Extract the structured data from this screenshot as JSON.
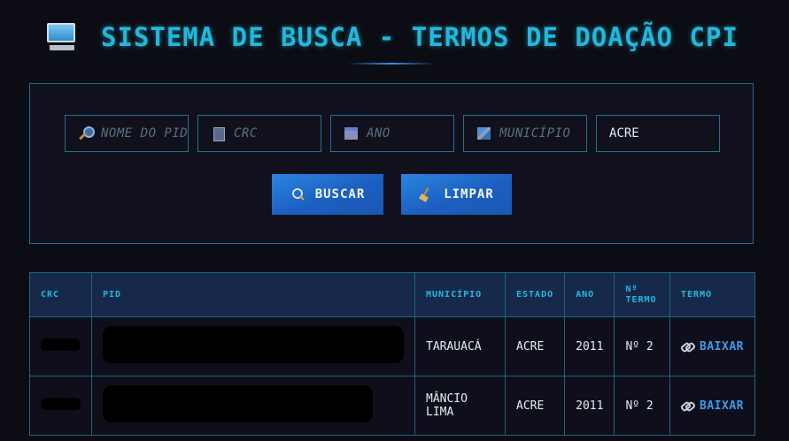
{
  "header": {
    "title": "SISTEMA DE BUSCA - TERMOS DE DOAÇÃO CPI",
    "icon": "computer-icon"
  },
  "search": {
    "fields": [
      {
        "name": "pid",
        "placeholder": "NOME DO PID",
        "value": "",
        "icon": "magnifier-icon"
      },
      {
        "name": "crc",
        "placeholder": "CRC",
        "value": "",
        "icon": "document-icon"
      },
      {
        "name": "ano",
        "placeholder": "ANO",
        "value": "",
        "icon": "calendar-icon"
      },
      {
        "name": "municipio",
        "placeholder": "MUNICÍPIO",
        "value": "",
        "icon": "city-icon"
      },
      {
        "name": "estado",
        "placeholder": "",
        "value": "ACRE",
        "icon": ""
      }
    ],
    "search_button": "BUSCAR",
    "clear_button": "LIMPAR"
  },
  "table": {
    "columns": [
      "CRC",
      "PID",
      "MUNICÍPIO",
      "ESTADO",
      "ANO",
      "Nº\nTERMO",
      "TERMO"
    ],
    "rows": [
      {
        "crc": "",
        "pid": "",
        "municipio": "TARAUACÁ",
        "estado": "ACRE",
        "ano": "2011",
        "termo_num": "Nº 2",
        "action": "BAIXAR"
      },
      {
        "crc": "",
        "pid": "",
        "municipio": "MÂNCIO LIMA",
        "estado": "ACRE",
        "ano": "2011",
        "termo_num": "Nº 2",
        "action": "BAIXAR"
      }
    ]
  },
  "colors": {
    "accent": "#22b8dc",
    "button": "#1f66c8",
    "link": "#3d9cf0",
    "background": "#0c0d14"
  }
}
